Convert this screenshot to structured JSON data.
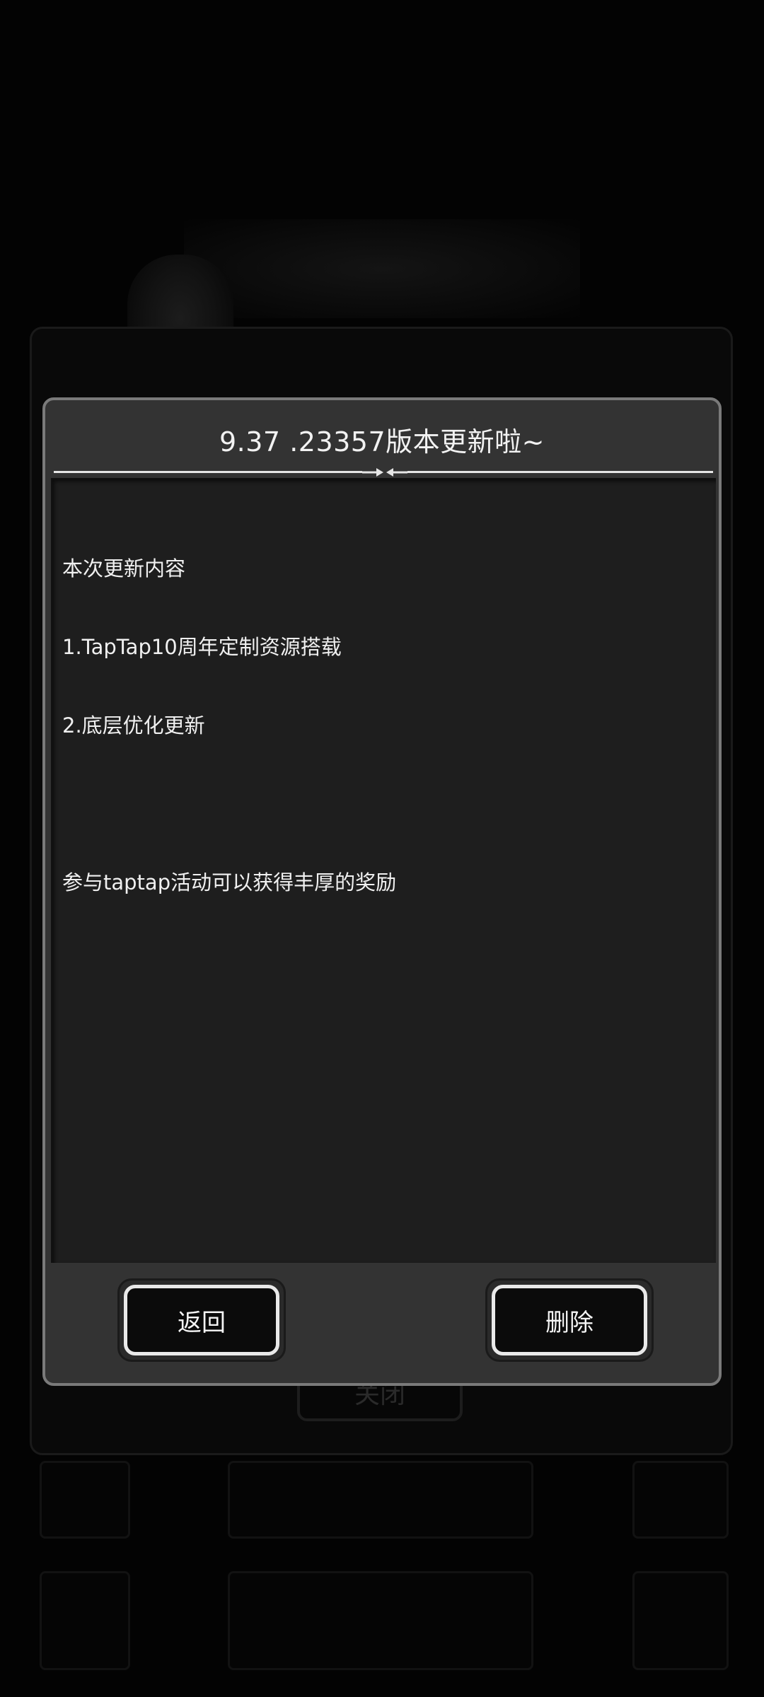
{
  "background": {
    "close_label": "关闭",
    "tile_labels": [
      "",
      ""
    ]
  },
  "dialog": {
    "title": "9.37 .23357版本更新啦~",
    "content_lines": [
      "本次更新内容",
      "1.TapTap10周年定制资源搭载",
      "2.底层优化更新",
      "",
      "参与taptap活动可以获得丰厚的奖励"
    ],
    "back_label": "返回",
    "delete_label": "删除"
  },
  "colors": {
    "dialog_bg": "#333333",
    "content_bg": "#1e1e1e",
    "button_border": "#e9e9e9",
    "text": "#f0f0f0"
  },
  "icons": {
    "divider_ornament": "double-arrow-ornament-icon"
  }
}
